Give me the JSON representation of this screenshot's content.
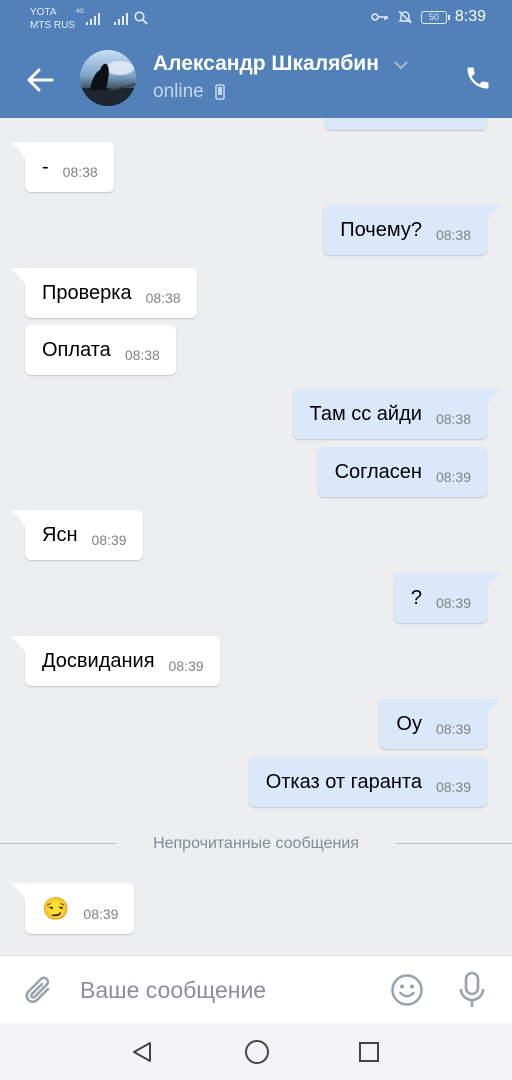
{
  "status_bar": {
    "carrier1": "YOTA",
    "carrier2": "MTS RUS",
    "network": "4G",
    "battery": "50",
    "time": "8:39"
  },
  "header": {
    "contact_name": "Александр Шкалябин",
    "status": "online"
  },
  "messages": [
    {
      "dir": "in",
      "text": "-",
      "time": "08:38"
    },
    {
      "dir": "out",
      "text": "Почему?",
      "time": "08:38"
    },
    {
      "dir": "in",
      "text": "Проверка",
      "time": "08:38"
    },
    {
      "dir": "in",
      "text": "Оплата",
      "time": "08:38"
    },
    {
      "dir": "out",
      "text": "Там сс айди",
      "time": "08:38"
    },
    {
      "dir": "out",
      "text": "Согласен",
      "time": "08:39"
    },
    {
      "dir": "in",
      "text": "Ясн",
      "time": "08:39"
    },
    {
      "dir": "out",
      "text": "?",
      "time": "08:39"
    },
    {
      "dir": "in",
      "text": "Досвидания",
      "time": "08:39"
    },
    {
      "dir": "out",
      "text": "Оу",
      "time": "08:39"
    },
    {
      "dir": "out",
      "text": "Отказ от гаранта",
      "time": "08:39"
    },
    {
      "dir": "in",
      "text": "😏",
      "time": "08:39"
    }
  ],
  "unread_divider": "Непрочитанные сообщения",
  "composer": {
    "placeholder": "Ваше сообщение"
  },
  "colors": {
    "header_bg": "#5181b8",
    "chat_bg": "#edeef0",
    "incoming_bubble": "#ffffff",
    "outgoing_bubble": "#dbe8fa",
    "icon_gray": "#99a2ad"
  },
  "icons": {
    "back": "arrow-left-icon",
    "dropdown": "chevron-down-icon",
    "call": "phone-icon",
    "device": "mobile-device-icon",
    "attach": "paperclip-icon",
    "emoji": "smile-icon",
    "voice": "microphone-icon",
    "nav_back": "triangle-back-icon",
    "nav_home": "circle-home-icon",
    "nav_recent": "square-recents-icon"
  }
}
